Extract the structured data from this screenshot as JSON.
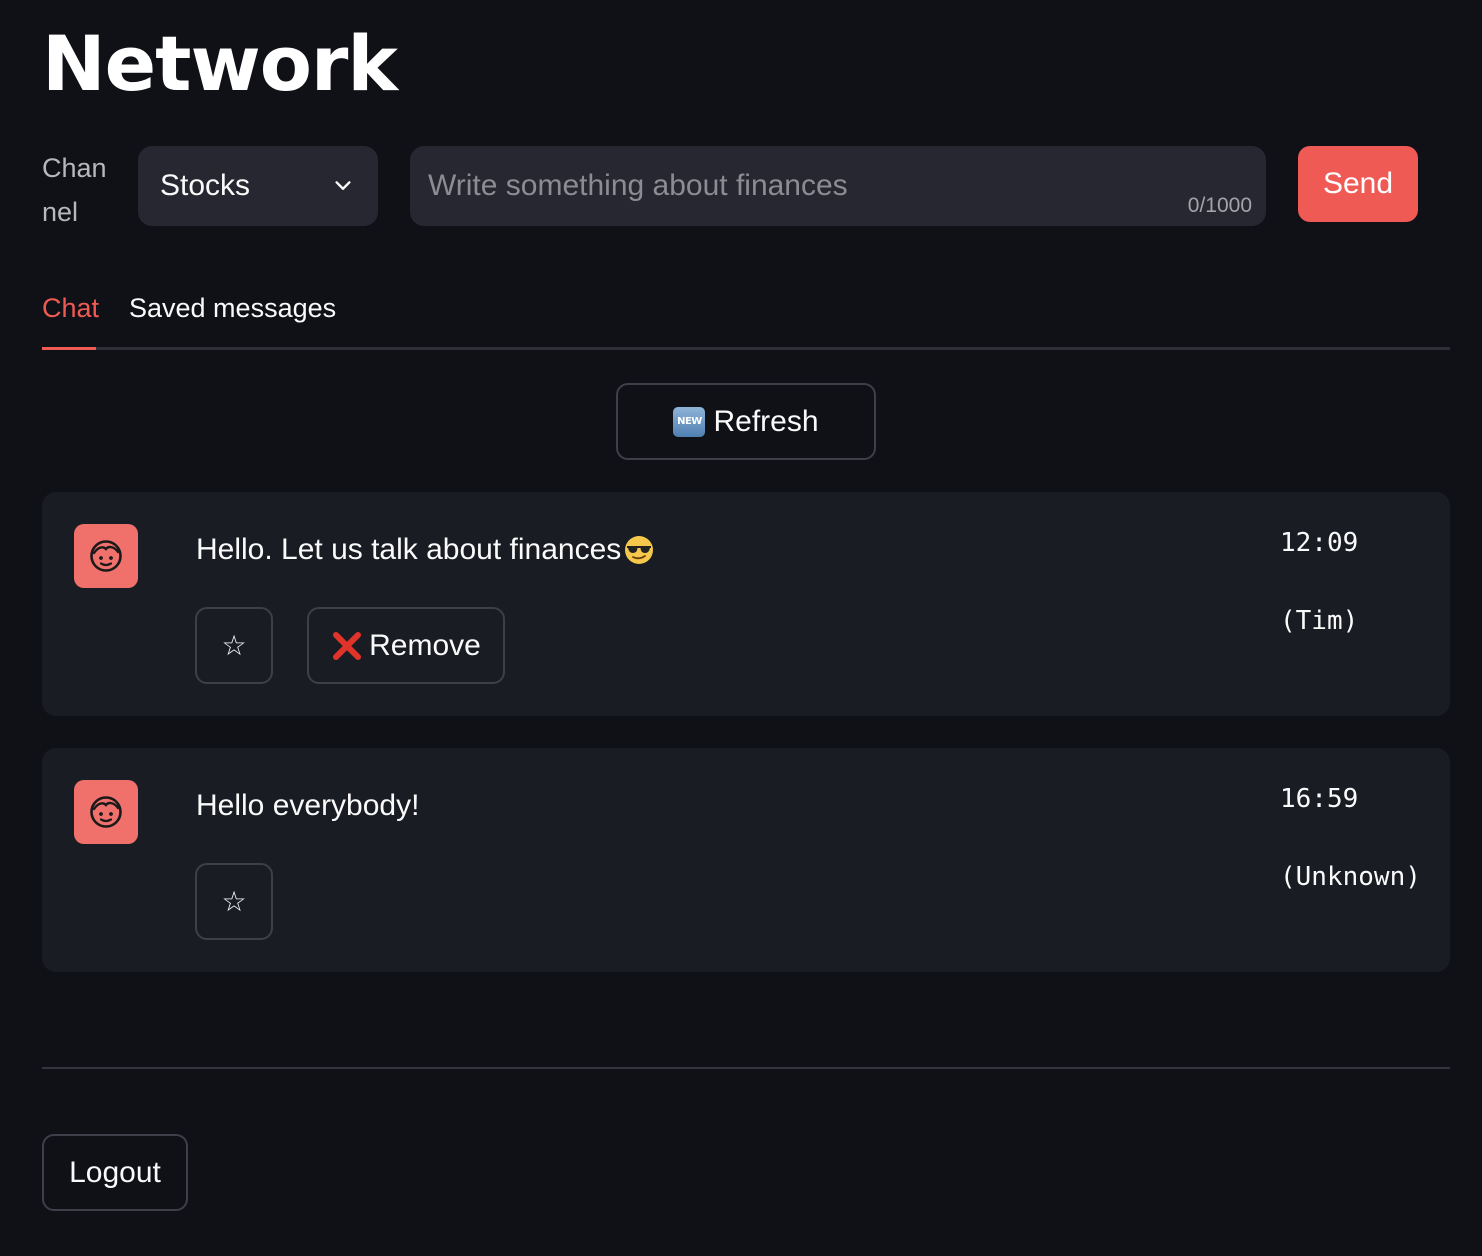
{
  "page": {
    "title": "Network"
  },
  "form": {
    "channel_label": "Channel",
    "channel_value": "Stocks",
    "message_placeholder": "Write something about finances",
    "message_value": "",
    "char_count": "0/1000",
    "send_label": "Send"
  },
  "tabs": [
    {
      "label": "Chat",
      "active": true
    },
    {
      "label": "Saved messages",
      "active": false
    }
  ],
  "refresh": {
    "icon": "new-emoji",
    "label": "Refresh"
  },
  "messages": [
    {
      "text": "Hello. Let us talk about finances",
      "emoji": "smiling-face-with-sunglasses",
      "time": "12:09",
      "author": "(Tim)",
      "can_remove": true,
      "remove_label": "Remove",
      "star_icon": "☆"
    },
    {
      "text": "Hello everybody!",
      "time": "16:59",
      "author": "(Unknown)",
      "can_remove": false,
      "star_icon": "☆"
    }
  ],
  "footer": {
    "logout_label": "Logout"
  },
  "colors": {
    "accent": "#ef5a55",
    "avatar": "#f0706b",
    "background": "#0f1117",
    "card": "#1a1c24",
    "input": "#262730"
  }
}
